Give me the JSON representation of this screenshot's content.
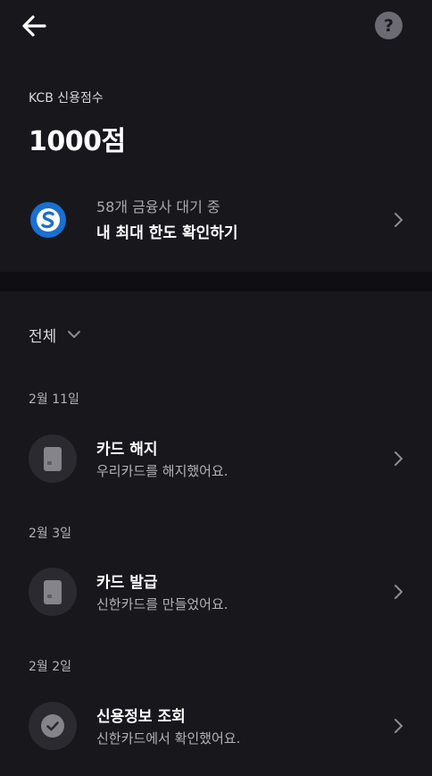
{
  "header": {
    "back_icon": "arrow-left-icon",
    "help_icon": "question-circle-icon",
    "help_glyph": "?"
  },
  "score": {
    "label": "KCB 신용점수",
    "value": "1000점"
  },
  "promo": {
    "logo_icon": "shinhan-logo-icon",
    "subtitle": "58개 금융사 대기 중",
    "title": "내 최대 한도 확인하기"
  },
  "filter": {
    "selected": "전체"
  },
  "history": [
    {
      "date": "2월 11일",
      "icon": "card-icon",
      "title": "카드 해지",
      "desc": "우리카드를 해지했어요."
    },
    {
      "date": "2월 3일",
      "icon": "card-icon",
      "title": "카드 발급",
      "desc": "신한카드를 만들었어요."
    },
    {
      "date": "2월 2일",
      "icon": "check-icon",
      "title": "신용정보 조회",
      "desc": "신한카드에서 확인했어요."
    }
  ],
  "colors": {
    "background": "#18171c",
    "section_divider": "#0f0e12",
    "icon_circle": "#2b2a30",
    "brand_blue": "#1a6fd0"
  }
}
